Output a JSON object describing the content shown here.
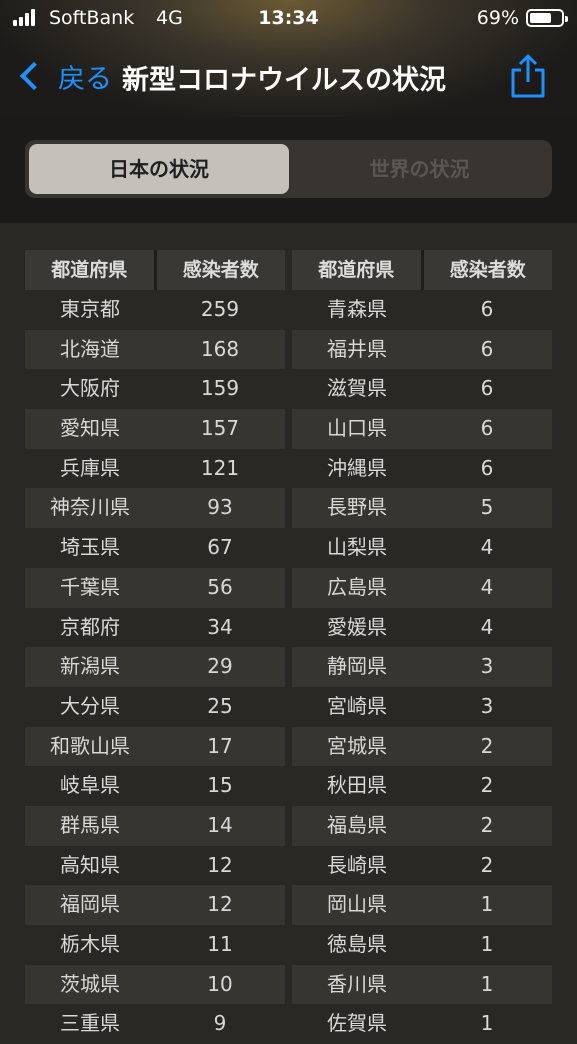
{
  "status": {
    "carrier": "SoftBank",
    "network": "4G",
    "time": "13:34",
    "battery": "69%",
    "battery_level": 0.69
  },
  "nav": {
    "back_label": "戻る",
    "title": "新型コロナウイルスの状況",
    "share_icon": "share-icon",
    "accent_color": "#1e90ff"
  },
  "segments": {
    "japan": "日本の状況",
    "world": "世界の状況",
    "selected": "japan"
  },
  "table": {
    "columns": [
      "都道府県",
      "感染者数",
      "都道府県",
      "感染者数"
    ],
    "left_rows": [
      [
        "東京都",
        "259"
      ],
      [
        "北海道",
        "168"
      ],
      [
        "大阪府",
        "159"
      ],
      [
        "愛知県",
        "157"
      ],
      [
        "兵庫県",
        "121"
      ],
      [
        "神奈川県",
        "93"
      ],
      [
        "埼玉県",
        "67"
      ],
      [
        "千葉県",
        "56"
      ],
      [
        "京都府",
        "34"
      ],
      [
        "新潟県",
        "29"
      ],
      [
        "大分県",
        "25"
      ],
      [
        "和歌山県",
        "17"
      ],
      [
        "岐阜県",
        "15"
      ],
      [
        "群馬県",
        "14"
      ],
      [
        "高知県",
        "12"
      ],
      [
        "福岡県",
        "12"
      ],
      [
        "栃木県",
        "11"
      ],
      [
        "茨城県",
        "10"
      ],
      [
        "三重県",
        "9"
      ]
    ],
    "right_rows": [
      [
        "青森県",
        "6"
      ],
      [
        "福井県",
        "6"
      ],
      [
        "滋賀県",
        "6"
      ],
      [
        "山口県",
        "6"
      ],
      [
        "沖縄県",
        "6"
      ],
      [
        "長野県",
        "5"
      ],
      [
        "山梨県",
        "4"
      ],
      [
        "広島県",
        "4"
      ],
      [
        "愛媛県",
        "4"
      ],
      [
        "静岡県",
        "3"
      ],
      [
        "宮崎県",
        "3"
      ],
      [
        "宮城県",
        "2"
      ],
      [
        "秋田県",
        "2"
      ],
      [
        "福島県",
        "2"
      ],
      [
        "長崎県",
        "2"
      ],
      [
        "岡山県",
        "1"
      ],
      [
        "徳島県",
        "1"
      ],
      [
        "香川県",
        "1"
      ],
      [
        "佐賀県",
        "1"
      ]
    ]
  }
}
